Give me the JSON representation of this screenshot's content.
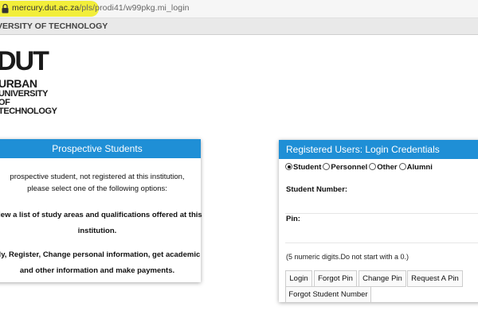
{
  "browser": {
    "url_host": "mercury.dut.ac.za",
    "url_path_a": "/pls/",
    "url_path_b": "prodi41",
    "url_path_c": "/w99pkg.mi_login",
    "highlight_color": "#f2ee3a",
    "lock_icon": "lock-icon"
  },
  "header": {
    "site_title": "VERSITY OF TECHNOLOGY"
  },
  "logo": {
    "mark": "DUT",
    "line1": "URBAN",
    "line2": "UNIVERSITY",
    "line3": "OF",
    "line4": "TECHNOLOGY"
  },
  "prospective": {
    "title": "Prospective Students",
    "intro": "prospective student, not registered at this institution, please select one of the following options:",
    "option1_line1": "View a list of study areas and qualifications offered at this",
    "option1_line2": "institution.",
    "option2_line1": "ply, Register, Change personal information, get academic",
    "option2_line2": "and other information and make payments."
  },
  "registered": {
    "title": "Registered Users: Login Credentials",
    "roles": [
      "Student",
      "Personnel",
      "Other",
      "Alumni"
    ],
    "selected_role": "Student",
    "student_number_label": "Student Number:",
    "student_number_value": "",
    "pin_label": "Pin:",
    "pin_value": "",
    "hint": "(5 numeric digits.Do not start with a 0.)",
    "buttons": {
      "login": "Login",
      "forgot_pin": "Forgot Pin",
      "change_pin": "Change Pin",
      "request_pin": "Request A Pin",
      "forgot_student_number": "Forgot Student Number"
    }
  },
  "colors": {
    "panel_header": "#1f8fd6",
    "header_band": "#e9e9e9"
  }
}
